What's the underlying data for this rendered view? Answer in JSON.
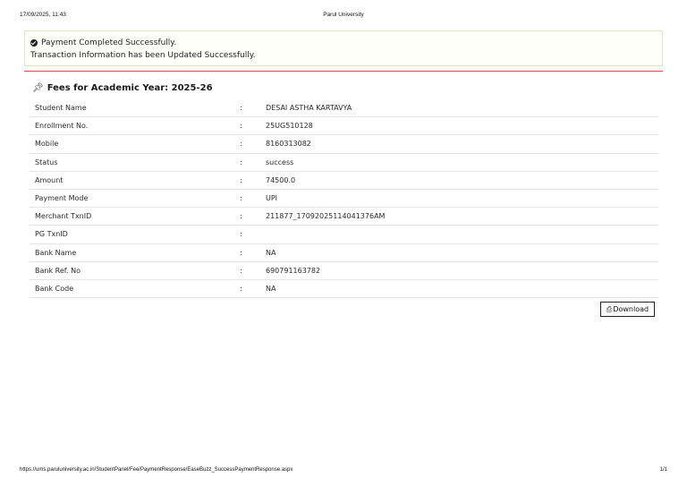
{
  "print_header": {
    "datetime": "17/09/2025, 11:43",
    "title": "Parul University"
  },
  "alert": {
    "icon": "check-circle-icon",
    "line1": "Payment Completed Successfully.",
    "line2": "Transaction Information has been Updated Successfully."
  },
  "section": {
    "icon": "pushpin-icon",
    "title": "Fees for Academic Year: 2025-26"
  },
  "details": [
    {
      "label": "Student Name",
      "sep": ":",
      "value": "DESAI ASTHA KARTAVYA"
    },
    {
      "label": "Enrollment No.",
      "sep": ":",
      "value": "25UG510128"
    },
    {
      "label": "Mobile",
      "sep": ":",
      "value": "8160313082"
    },
    {
      "label": "Status",
      "sep": ":",
      "value": "success"
    },
    {
      "label": "Amount",
      "sep": ":",
      "value": "74500.0"
    },
    {
      "label": "Payment Mode",
      "sep": ":",
      "value": "UPI"
    },
    {
      "label": "Merchant TxnID",
      "sep": ":",
      "value": "211877_17092025114041376AM"
    },
    {
      "label": "PG TxnID",
      "sep": ":",
      "value": ""
    },
    {
      "label": "Bank Name",
      "sep": ":",
      "value": "NA"
    },
    {
      "label": "Bank Ref. No",
      "sep": ":",
      "value": "690791163782"
    },
    {
      "label": "Bank Code",
      "sep": ":",
      "value": "NA"
    }
  ],
  "download_button": {
    "icon": "print-icon",
    "label": "Download"
  },
  "print_footer": {
    "url": "https://ums.paruluniversity.ac.in/StudentPanel/Fee/PaymentResponse/EaseBuzz_SuccessPaymentResponse.aspx",
    "page": "1/1"
  },
  "colors": {
    "divider": "#d94a4a",
    "alert_border": "#e6e0c4",
    "row_border": "#e4e4e4"
  }
}
